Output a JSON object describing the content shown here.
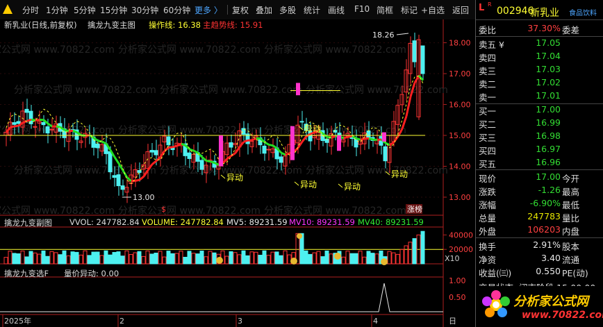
{
  "toolbar": {
    "periods": [
      "分时",
      "1分钟",
      "5分钟",
      "15分钟",
      "30分钟",
      "60分钟"
    ],
    "more": "更多 〉",
    "tools": [
      "复权",
      "叠加",
      "多股",
      "统计",
      "画线",
      "F10",
      "简框",
      "标记",
      "+自选",
      "返回"
    ]
  },
  "stock_badge": {
    "L": "L",
    "R": "R",
    "code": "002946",
    "name": "新乳业",
    "tag": "食品饮料"
  },
  "main_header": {
    "title": "新乳业(日线,前复权)",
    "indicator": "擒龙九变主图",
    "op_label": "操作线: 16.38",
    "trend_label": "主趋势线: 15.91"
  },
  "price_axis": [
    "18.00",
    "17.00",
    "16.00",
    "15.00",
    "14.00",
    "13.00"
  ],
  "annotations": {
    "high": "18.26",
    "low": "13.00",
    "yidong": "异动",
    "zhangbang": "涨榜",
    "dollar": "$"
  },
  "vol_header": {
    "title": "擒龙九变副图",
    "vvol": "VVOL: 247782.84",
    "volume": "VOLUME: 247782.84",
    "mv5": "MV5: 89231.59",
    "mv10": "MV10: 89231.59",
    "mv40": "MV40: 89231.59"
  },
  "vol_axis": [
    "40000",
    "20000"
  ],
  "vol_unit": "X10",
  "sel_header": {
    "title": "擒龙九变选F",
    "value": "量价异动: 0.00"
  },
  "sel_axis": [
    "1.00",
    "0.50"
  ],
  "date_axis": [
    "2025年",
    "2",
    "3",
    "4"
  ],
  "date_unit": "日",
  "watermark": "分析家公式网 www.70822.com",
  "quote": {
    "weibi_label": "委比",
    "weibi": "37.30%",
    "weicha_label": "委差",
    "sell": [
      {
        "label": "卖五 ¥",
        "price": "17.05"
      },
      {
        "label": "卖四",
        "price": "17.04"
      },
      {
        "label": "卖三",
        "price": "17.03"
      },
      {
        "label": "卖二",
        "price": "17.02"
      },
      {
        "label": "卖一",
        "price": "17.01"
      }
    ],
    "buy": [
      {
        "label": "买一",
        "price": "17.00"
      },
      {
        "label": "买二",
        "price": "16.99"
      },
      {
        "label": "买三",
        "price": "16.98"
      },
      {
        "label": "买四",
        "price": "16.97"
      },
      {
        "label": "买五",
        "price": "16.96"
      }
    ],
    "stats": [
      {
        "label": "现价",
        "value": "17.00",
        "label2": "今开",
        "color": "green"
      },
      {
        "label": "涨跌",
        "value": "-1.26",
        "label2": "最高",
        "color": "green"
      },
      {
        "label": "涨幅",
        "value": "-6.90%",
        "label2": "最低",
        "color": "green"
      },
      {
        "label": "总量",
        "value": "247783",
        "label2": "量比",
        "color": "yel"
      },
      {
        "label": "外盘",
        "value": "106203",
        "label2": "内盘",
        "color": "red"
      }
    ],
    "stats2": [
      {
        "label": "换手",
        "value": "2.91%",
        "label2": "股本"
      },
      {
        "label": "净资",
        "value": "3.40",
        "label2": "流通"
      },
      {
        "label": "收益(㈢)",
        "value": "0.550",
        "label2": "PE(动)"
      }
    ],
    "trade_status": "交易状态: 闭市阶段 15:00:00"
  },
  "logo": {
    "title": "分析家公式网",
    "url": "www.70822.com"
  },
  "colors": {
    "up": "#ff3333",
    "down": "#4df0f0",
    "green": "#22dd22",
    "pink": "#ff33cc",
    "yellow": "#ffff33"
  }
}
